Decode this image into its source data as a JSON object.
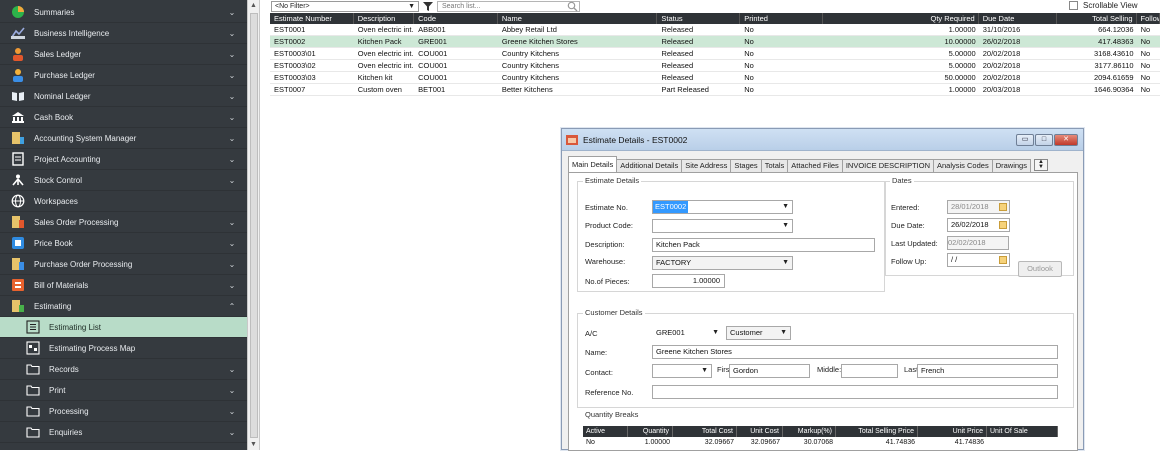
{
  "sidebar": {
    "items": [
      {
        "label": "Summaries",
        "icon": "pie-chart-icon",
        "chevron": "⌄"
      },
      {
        "label": "Business Intelligence",
        "icon": "bi-icon",
        "chevron": "⌄"
      },
      {
        "label": "Sales Ledger",
        "icon": "sales-ledger-icon",
        "chevron": "⌄"
      },
      {
        "label": "Purchase Ledger",
        "icon": "purchase-ledger-icon",
        "chevron": "⌄"
      },
      {
        "label": "Nominal Ledger",
        "icon": "nominal-ledger-icon",
        "chevron": "⌄"
      },
      {
        "label": "Cash Book",
        "icon": "cash-book-icon",
        "chevron": "⌄"
      },
      {
        "label": "Accounting System Manager",
        "icon": "accounting-manager-icon",
        "chevron": "⌄"
      },
      {
        "label": "Project Accounting",
        "icon": "project-accounting-icon",
        "chevron": "⌄"
      },
      {
        "label": "Stock Control",
        "icon": "stock-control-icon",
        "chevron": "⌄"
      },
      {
        "label": "Workspaces",
        "icon": "globe-icon",
        "chevron": ""
      },
      {
        "label": "Sales Order Processing",
        "icon": "sales-order-icon",
        "chevron": "⌄"
      },
      {
        "label": "Price Book",
        "icon": "price-book-icon",
        "chevron": "⌄"
      },
      {
        "label": "Purchase Order Processing",
        "icon": "purchase-order-icon",
        "chevron": "⌄"
      },
      {
        "label": "Bill of Materials",
        "icon": "bill-of-materials-icon",
        "chevron": "⌄"
      },
      {
        "label": "Estimating",
        "icon": "estimating-icon",
        "chevron": "⌃"
      },
      {
        "label": "Estimating List",
        "icon": "list-icon",
        "chevron": "",
        "sub": true,
        "active": true
      },
      {
        "label": "Estimating Process Map",
        "icon": "process-map-icon",
        "chevron": "",
        "sub": true
      },
      {
        "label": "Records",
        "icon": "folder-icon",
        "chevron": "⌄",
        "sub": true
      },
      {
        "label": "Print",
        "icon": "folder-icon",
        "chevron": "⌄",
        "sub": true
      },
      {
        "label": "Processing",
        "icon": "folder-icon",
        "chevron": "⌄",
        "sub": true
      },
      {
        "label": "Enquiries",
        "icon": "folder-icon",
        "chevron": "⌄",
        "sub": true
      }
    ]
  },
  "toolbar": {
    "filter_value": "<No Filter>",
    "search_placeholder": "Search list...",
    "scrollable_label": "Scrollable View"
  },
  "grid": {
    "headers": [
      "Estimate Number",
      "Description",
      "Code",
      "Name",
      "Status",
      "Printed",
      "Qty Required",
      "Due Date",
      "Total Selling",
      "Follow"
    ],
    "rows": [
      [
        "EST0001",
        "Oven electric int...",
        "ABB001",
        "Abbey Retail Ltd",
        "Released",
        "No",
        "1.00000",
        "31/10/2016",
        "664.12036",
        "No"
      ],
      [
        "EST0002",
        "Kitchen Pack",
        "GRE001",
        "Greene Kitchen Stores",
        "Released",
        "No",
        "10.00000",
        "26/02/2018",
        "417.48363",
        "No"
      ],
      [
        "EST0003\\01",
        "Oven electric int...",
        "COU001",
        "Country Kitchens",
        "Released",
        "No",
        "5.00000",
        "20/02/2018",
        "3168.43610",
        "No"
      ],
      [
        "EST0003\\02",
        "Oven electric int...",
        "COU001",
        "Country Kitchens",
        "Released",
        "No",
        "5.00000",
        "20/02/2018",
        "3177.86110",
        "No"
      ],
      [
        "EST0003\\03",
        "Kitchen kit",
        "COU001",
        "Country Kitchens",
        "Released",
        "No",
        "50.00000",
        "20/02/2018",
        "2094.61659",
        "No"
      ],
      [
        "EST0007",
        "Custom oven",
        "BET001",
        "Better Kitchens",
        "Part Released",
        "No",
        "1.00000",
        "20/03/2018",
        "1646.90364",
        "No"
      ]
    ],
    "selected_row": 1
  },
  "dialog": {
    "title": "Estimate Details - EST0002",
    "tabs": [
      "Main Details",
      "Additional Details",
      "Site Address",
      "Stages",
      "Totals",
      "Attached Files",
      "INVOICE DESCRIPTION",
      "Analysis Codes",
      "Drawings"
    ],
    "estimate_details": {
      "group_label": "Estimate Details",
      "estimate_no_label": "Estimate No.",
      "estimate_no": "EST0002",
      "product_code_label": "Product Code:",
      "product_code": "",
      "description_label": "Description:",
      "description": "Kitchen Pack",
      "warehouse_label": "Warehouse:",
      "warehouse": "FACTORY",
      "pieces_label": "No.of Pieces:",
      "pieces": "1.00000"
    },
    "dates": {
      "group_label": "Dates",
      "entered_label": "Entered:",
      "entered": "28/01/2018",
      "due_label": "Due Date:",
      "due": "26/02/2018",
      "last_updated_label": "Last Updated:",
      "last_updated": "02/02/2018",
      "follow_up_label": "Follow Up:",
      "follow_up": " / /",
      "outlook_label": "Outlook"
    },
    "customer": {
      "group_label": "Customer Details",
      "ac_label": "A/C",
      "ac": "GRE001",
      "type": "Customer",
      "name_label": "Name:",
      "name": "Greene Kitchen Stores",
      "contact_label": "Contact:",
      "contact": "",
      "first_label": "First:",
      "first": "Gordon",
      "middle_label": "Middle:",
      "middle": "",
      "last_label": "Last:",
      "last": "French",
      "reference_label": "Reference No.",
      "reference": ""
    },
    "quantity_breaks": {
      "group_label": "Quantity Breaks",
      "headers": [
        "Active",
        "Quantity",
        "Total Cost",
        "Unit Cost",
        "Markup(%)",
        "Total Selling Price",
        "Unit Price",
        "Unit Of Sale"
      ],
      "rows": [
        [
          "No",
          "1.00000",
          "32.09667",
          "32.09667",
          "30.07068",
          "41.74836",
          "41.74836",
          ""
        ]
      ]
    }
  }
}
